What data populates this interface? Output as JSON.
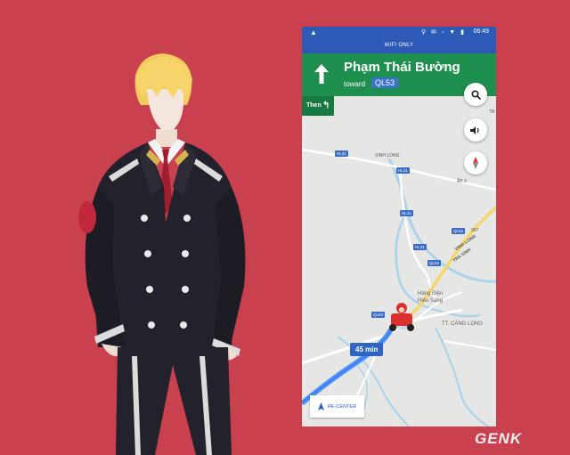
{
  "status_bar": {
    "left_icon": "navigation-arrow-icon",
    "icons_text": "⚲ ✉ ◦ ▼ ▮",
    "time": "06:49"
  },
  "wifi_banner": "WIFI ONLY",
  "navigation": {
    "street": "Phạm Thái Bường",
    "toward_label": "toward",
    "route": "QL53",
    "then_label": "Then",
    "then_icon": "turn-left-icon"
  },
  "map": {
    "labels": {
      "vinh_long_top": "VINH LONG",
      "ap3": "ẤP 3",
      "tr": "TR",
      "vinh_long_diag": "VINH LONG",
      "tra_vinh": "TRA VINH",
      "shop_line1": "Hàng Điện",
      "shop_line2": "Hiếu Sáng",
      "tt_cang_long": "TT. CÀNG LONG",
      "road_907": "907"
    },
    "shields": {
      "hl31_a": "HL31",
      "hl31_b": "HL31",
      "hl31_c": "HL31",
      "hl31_d": "HL31",
      "ql53_a": "QL53",
      "ql53_b": "QL53",
      "ql53_c": "QL53"
    }
  },
  "buttons": {
    "search_icon": "search-icon",
    "sound_icon": "volume-icon",
    "compass_icon": "compass-icon"
  },
  "eta": "45 min",
  "recenter_label": "RE-CENTER",
  "watermark": "GENK",
  "colors": {
    "background": "#c9404f",
    "nav_green": "#1e8f4f",
    "status_blue": "#2d5ab6",
    "route_blue": "#4285f4"
  }
}
